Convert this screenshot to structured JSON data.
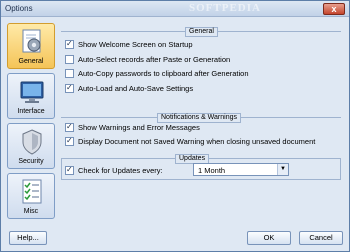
{
  "window": {
    "title": "Options",
    "watermark": "SOFTPEDIA",
    "close_glyph": "x"
  },
  "sidebar": {
    "items": [
      {
        "label": "General",
        "icon": "gear-document-icon",
        "active": true
      },
      {
        "label": "Interface",
        "icon": "monitor-icon",
        "active": false
      },
      {
        "label": "Security",
        "icon": "shield-icon",
        "active": false
      },
      {
        "label": "Misc",
        "icon": "checklist-icon",
        "active": false
      }
    ]
  },
  "sections": {
    "general": {
      "title": "General",
      "options": [
        {
          "label": "Show Welcome Screen on Startup",
          "checked": true
        },
        {
          "label": "Auto-Select records after Paste or Generation",
          "checked": false
        },
        {
          "label": "Auto-Copy passwords to clipboard after Generation",
          "checked": false
        },
        {
          "label": "Auto-Load and Auto-Save Settings",
          "checked": true
        }
      ]
    },
    "notifications": {
      "title": "Notifications & Warnings",
      "options": [
        {
          "label": "Show Warnings and Error Messages",
          "checked": true
        },
        {
          "label": "Display Document not Saved Warning when closing unsaved document",
          "checked": true
        }
      ]
    },
    "updates": {
      "title": "Updates",
      "check_label": "Check for Updates every:",
      "checked": true,
      "interval_value": "1 Month"
    }
  },
  "buttons": {
    "help": "Help...",
    "ok": "OK",
    "cancel": "Cancel"
  }
}
